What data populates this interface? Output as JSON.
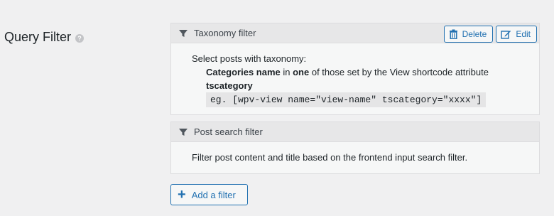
{
  "section": {
    "label": "Query Filter",
    "help_icon": "?"
  },
  "filters": [
    {
      "icon": "funnel-icon",
      "title": "Taxonomy filter",
      "actions": {
        "delete_label": "Delete",
        "delete_icon": "trash-icon",
        "edit_label": "Edit",
        "edit_icon": "edit-icon"
      },
      "body": {
        "intro": "Select posts with taxonomy:",
        "taxonomy_name": "Categories name",
        "in_text": " in ",
        "one_text": "one",
        "rest_text": " of those set by the View shortcode attribute",
        "attribute": "tscategory",
        "example": "eg. [wpv-view name=\"view-name\" tscategory=\"xxxx\"]"
      }
    },
    {
      "icon": "funnel-icon",
      "title": "Post search filter",
      "body": {
        "text": "Filter post content and title based on the frontend input search filter."
      }
    }
  ],
  "add_filter": {
    "icon": "+",
    "label": "Add a filter"
  },
  "colors": {
    "accent": "#2271b1",
    "background": "#f0f0f1",
    "panel": "#f6f7f7",
    "header": "#e7e7e8"
  }
}
